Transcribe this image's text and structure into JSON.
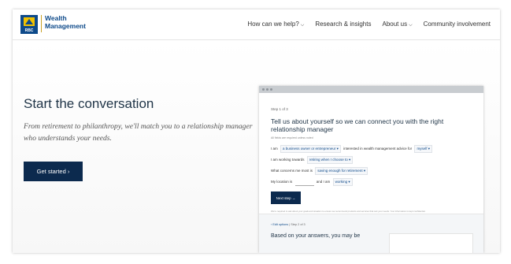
{
  "brand": {
    "logo_text": "RBC",
    "line1": "Wealth",
    "line2": "Management"
  },
  "nav": {
    "items": [
      "How can we help?",
      "Research & insights",
      "About us",
      "Community involvement"
    ]
  },
  "hero": {
    "title": "Start the conversation",
    "subtitle": "From retirement to philanthropy, we'll match you to a relationship manager who understands your needs.",
    "cta": "Get started ›"
  },
  "mock": {
    "step": "Step 1 of 3",
    "title": "Tell us about yourself so we can connect you with the right relationship manager",
    "required_note": "All fields are required unless noted",
    "row1": {
      "a": "I am",
      "b": "a business owner or entrepreneur ▾",
      "c": "interested in wealth management advice for",
      "d": "myself ▾"
    },
    "row2": {
      "a": "I am working towards",
      "b": "retiring when I choose to ▾"
    },
    "row3": {
      "a": "What concerns me most is",
      "b": "saving enough for retirement ▾"
    },
    "row4": {
      "a": "My location is",
      "b": "and I am",
      "c": "working ▾"
    },
    "next": "Next step →",
    "fine_print": "We're required to ask about your goals and situation to ensure we recommend products and services that suit your needs. Your information is kept confidential.",
    "lower_link": "‹ Edit options",
    "lower_sep": "|",
    "lower_step": "Step 2 of 3",
    "lower_title": "Based on your answers, you may be"
  },
  "colors": {
    "navy": "#0c2a4e",
    "brand_blue": "#0e4a8a",
    "gold": "#c9a227"
  }
}
